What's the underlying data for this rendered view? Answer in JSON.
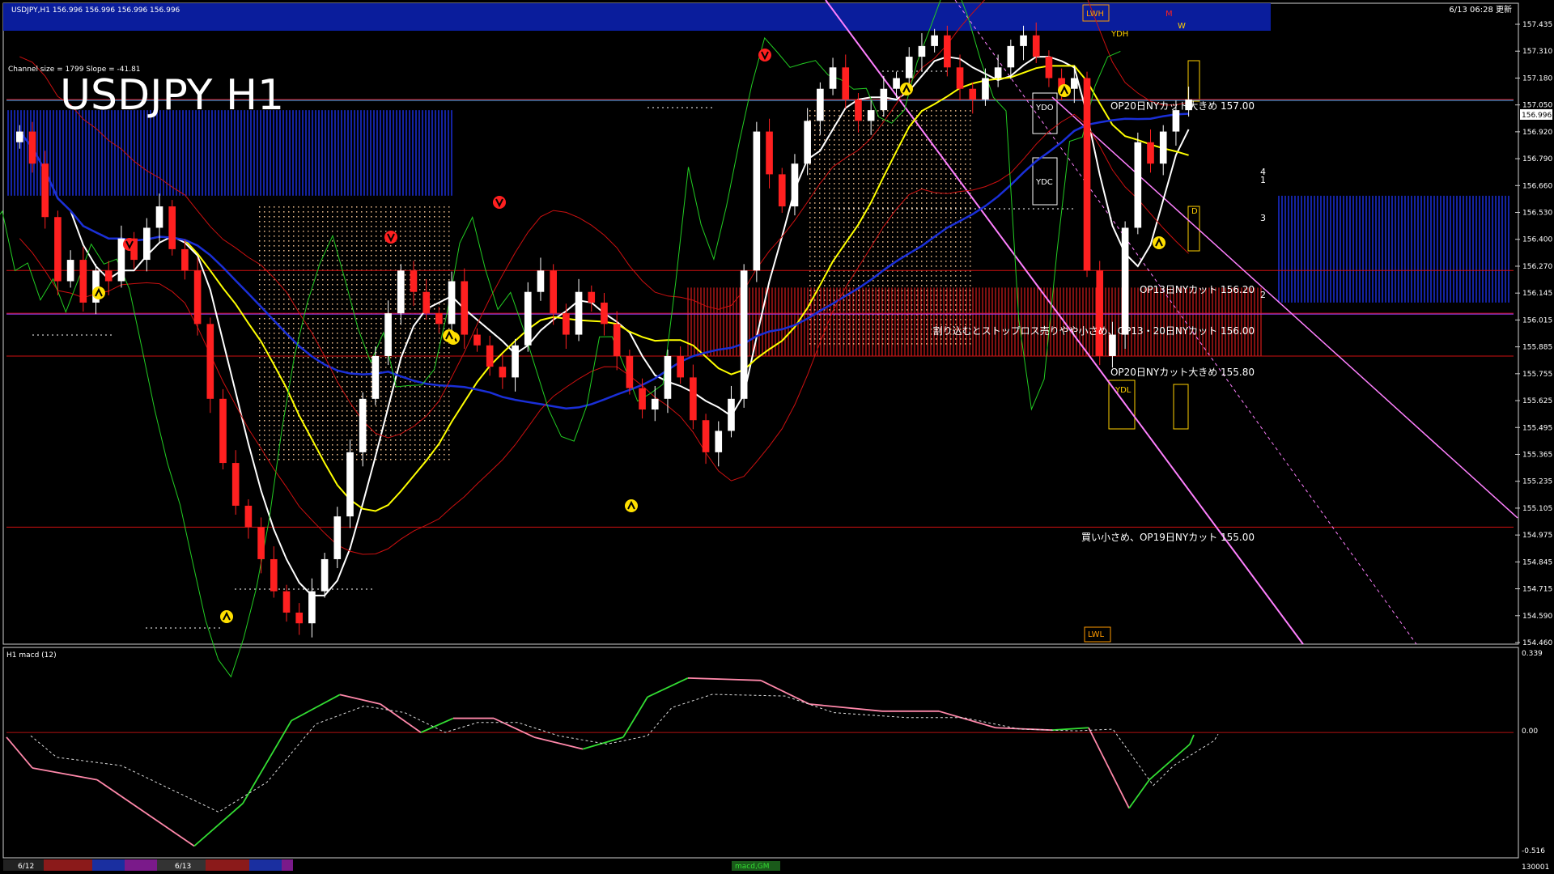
{
  "header": {
    "symbol_line": "USDJPY,H1   156.996 156.996 156.996 156.996",
    "datetime": "6/13 06:28 更新"
  },
  "title_big": "USDJPY H1",
  "channel_info": "Channel size = 1799 Slope = -41.81",
  "sub_label": "H1  macd (12)",
  "colors": {
    "background": "#000000",
    "bull": "#ffffff",
    "bear": "#ff2020",
    "ma_fast": "#ffffff",
    "ma_mid": "#ffff00",
    "ma_slow": "#1a2fd8",
    "bollinger": "#cc1010",
    "chikou": "#22cc22",
    "kumo_blue": "#1a2fd8",
    "kumo_red": "#ff2020",
    "kumo_dot": "#f0c090",
    "hline_red": "#d01010",
    "hline_cyan": "#4ab0ff",
    "channel": "#ff80ff",
    "title_bar": "#0a1d9c",
    "macd_up": "#33dd33",
    "macd_down": "#ff88aa",
    "signal": "#dddddd"
  },
  "price_axis_ticks": [
    "157.435",
    "157.310",
    "157.180",
    "157.050",
    "156.920",
    "156.790",
    "156.660",
    "156.530",
    "156.400",
    "156.270",
    "156.145",
    "156.015",
    "155.885",
    "155.755",
    "155.625",
    "155.495",
    "155.365",
    "155.235",
    "155.105",
    "154.975",
    "154.845",
    "154.715",
    "154.590",
    "154.460"
  ],
  "current_price": "156.996",
  "macd_axis": {
    "top": "0.339",
    "zero": "0.00",
    "bottom": "-0.516"
  },
  "time_labels": [
    "6/12",
    "6/13"
  ],
  "bottom_tab": "macd,GM",
  "bottom_right_value": "130001",
  "box_labels": {
    "lwh": "LWH",
    "ydh": "YDH",
    "ydo": "YDO",
    "ydc": "YDC",
    "ydl": "YDL",
    "lwl": "LWL",
    "m": "M",
    "w": "W",
    "d": "D"
  },
  "annotations": [
    {
      "text": "OP20日NYカット大きめ 157.00",
      "price": 157.0
    },
    {
      "text": "OP13日NYカット 156.20",
      "price": 156.2
    },
    {
      "text": "割り込むとストップロス売りやや小さめ、OP13・20日NYカット 156.00",
      "price": 156.0
    },
    {
      "text": "OP20日NYカット大きめ 155.80",
      "price": 155.8
    },
    {
      "text": "買い小さめ、OP19日NYカット 155.00",
      "price": 155.0
    }
  ],
  "channel_numbers": [
    "4",
    "1",
    "3",
    "2"
  ],
  "chart_data": {
    "type": "candlestick",
    "title": "USDJPY H1",
    "x_range": [
      "6/12",
      "6/13"
    ],
    "y_range": [
      154.46,
      157.435
    ],
    "horizontal_levels": [
      157.0,
      156.2,
      156.0,
      155.8,
      155.0
    ],
    "last_price": 156.996,
    "closes": [
      156.85,
      156.7,
      156.45,
      156.15,
      156.25,
      156.05,
      156.2,
      156.15,
      156.35,
      156.25,
      156.4,
      156.5,
      156.3,
      156.2,
      155.95,
      155.6,
      155.3,
      155.1,
      155.0,
      154.85,
      154.7,
      154.6,
      154.55,
      154.7,
      154.85,
      155.05,
      155.35,
      155.6,
      155.8,
      156.0,
      156.2,
      156.1,
      156.0,
      155.95,
      156.15,
      155.9,
      155.85,
      155.75,
      155.7,
      155.85,
      156.1,
      156.2,
      156.0,
      155.9,
      156.1,
      156.05,
      155.95,
      155.8,
      155.65,
      155.55,
      155.6,
      155.8,
      155.7,
      155.5,
      155.35,
      155.45,
      155.6,
      156.2,
      156.85,
      156.65,
      156.5,
      156.7,
      156.9,
      157.05,
      157.15,
      157.0,
      156.9,
      156.95,
      157.05,
      157.1,
      157.2,
      157.25,
      157.3,
      157.15,
      157.05,
      157.0,
      157.1,
      157.15,
      157.25,
      157.3,
      157.2,
      157.1,
      157.05,
      157.1,
      156.2,
      155.8,
      155.9,
      156.4,
      156.8,
      156.7,
      156.85,
      156.95,
      157.0
    ],
    "macd": {
      "range": [
        -0.516,
        0.339
      ],
      "zero": 0.0
    }
  }
}
